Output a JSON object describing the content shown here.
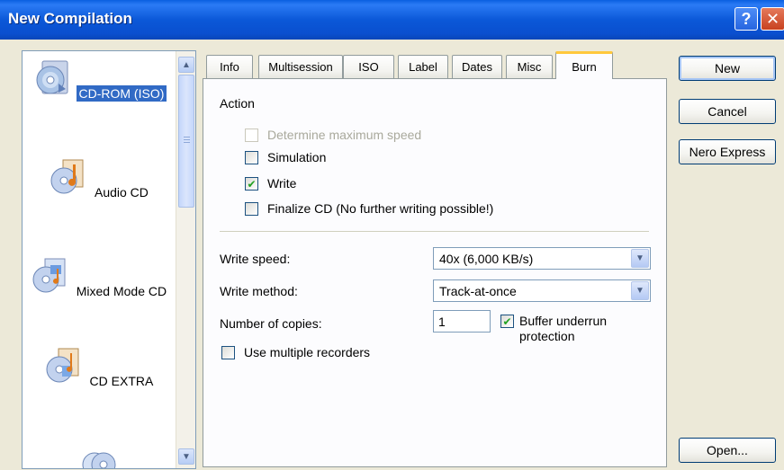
{
  "window": {
    "title": "New Compilation",
    "help_symbol": "?",
    "close_symbol": "✕"
  },
  "compilations": [
    {
      "label": "CD-ROM (ISO)",
      "icon": "cd-rom-iso-icon",
      "selected": true
    },
    {
      "label": "Audio CD",
      "icon": "audio-cd-icon",
      "selected": false
    },
    {
      "label": "Mixed Mode CD",
      "icon": "mixed-mode-cd-icon",
      "selected": false
    },
    {
      "label": "CD EXTRA",
      "icon": "cd-extra-icon",
      "selected": false
    },
    {
      "label": "",
      "icon": "cd-copy-icon",
      "selected": false
    }
  ],
  "tabs": [
    {
      "label": "Info"
    },
    {
      "label": "Multisession"
    },
    {
      "label": "ISO"
    },
    {
      "label": "Label"
    },
    {
      "label": "Dates"
    },
    {
      "label": "Misc"
    },
    {
      "label": "Burn",
      "active": true
    }
  ],
  "burn": {
    "action_heading": "Action",
    "determine_max_speed": {
      "label": "Determine maximum speed",
      "checked": false,
      "enabled": false
    },
    "simulation": {
      "label": "Simulation",
      "checked": false
    },
    "write": {
      "label": "Write",
      "checked": true,
      "check_mark": "✔"
    },
    "finalize": {
      "label": "Finalize CD (No further writing possible!)",
      "checked": false
    },
    "write_speed": {
      "label": "Write speed:",
      "value": "40x (6,000 KB/s)"
    },
    "write_method": {
      "label": "Write method:",
      "value": "Track-at-once"
    },
    "copies": {
      "label": "Number of copies:",
      "value": "1"
    },
    "buffer_underrun": {
      "label_line1": "Buffer underrun",
      "label_line2": "protection",
      "checked": true,
      "check_mark": "✔"
    },
    "multiple_recorders": {
      "label": "Use multiple recorders",
      "checked": false
    }
  },
  "buttons": {
    "new": "New",
    "cancel": "Cancel",
    "nero_express": "Nero Express",
    "open": "Open..."
  },
  "colors": {
    "titlebar": "#0b58d8",
    "selection": "#316ac5",
    "dialog_bg": "#ece9d8",
    "tab_highlight": "#ffc83c",
    "check_green": "#21a121"
  }
}
